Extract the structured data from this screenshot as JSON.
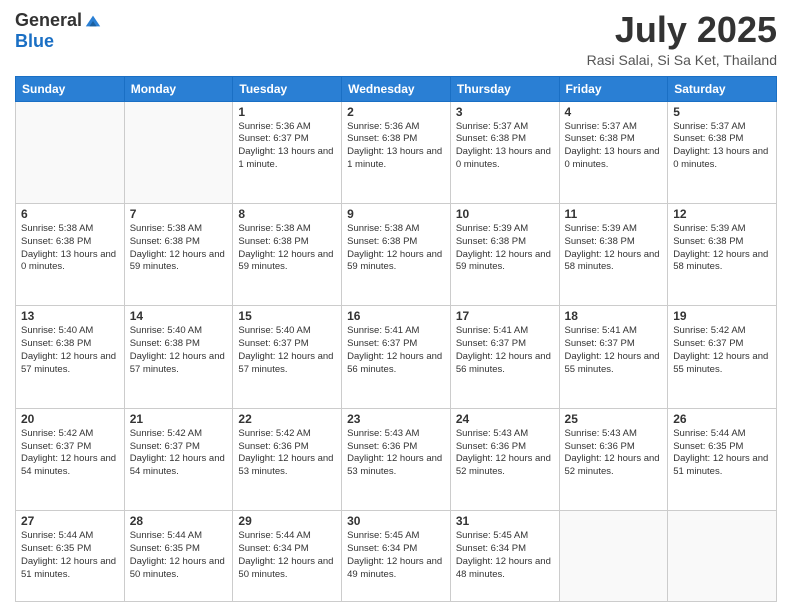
{
  "logo": {
    "general": "General",
    "blue": "Blue"
  },
  "header": {
    "month": "July 2025",
    "location": "Rasi Salai, Si Sa Ket, Thailand"
  },
  "days_of_week": [
    "Sunday",
    "Monday",
    "Tuesday",
    "Wednesday",
    "Thursday",
    "Friday",
    "Saturday"
  ],
  "weeks": [
    [
      {
        "day": "",
        "info": ""
      },
      {
        "day": "",
        "info": ""
      },
      {
        "day": "1",
        "info": "Sunrise: 5:36 AM\nSunset: 6:37 PM\nDaylight: 13 hours and 1 minute."
      },
      {
        "day": "2",
        "info": "Sunrise: 5:36 AM\nSunset: 6:38 PM\nDaylight: 13 hours and 1 minute."
      },
      {
        "day": "3",
        "info": "Sunrise: 5:37 AM\nSunset: 6:38 PM\nDaylight: 13 hours and 0 minutes."
      },
      {
        "day": "4",
        "info": "Sunrise: 5:37 AM\nSunset: 6:38 PM\nDaylight: 13 hours and 0 minutes."
      },
      {
        "day": "5",
        "info": "Sunrise: 5:37 AM\nSunset: 6:38 PM\nDaylight: 13 hours and 0 minutes."
      }
    ],
    [
      {
        "day": "6",
        "info": "Sunrise: 5:38 AM\nSunset: 6:38 PM\nDaylight: 13 hours and 0 minutes."
      },
      {
        "day": "7",
        "info": "Sunrise: 5:38 AM\nSunset: 6:38 PM\nDaylight: 12 hours and 59 minutes."
      },
      {
        "day": "8",
        "info": "Sunrise: 5:38 AM\nSunset: 6:38 PM\nDaylight: 12 hours and 59 minutes."
      },
      {
        "day": "9",
        "info": "Sunrise: 5:38 AM\nSunset: 6:38 PM\nDaylight: 12 hours and 59 minutes."
      },
      {
        "day": "10",
        "info": "Sunrise: 5:39 AM\nSunset: 6:38 PM\nDaylight: 12 hours and 59 minutes."
      },
      {
        "day": "11",
        "info": "Sunrise: 5:39 AM\nSunset: 6:38 PM\nDaylight: 12 hours and 58 minutes."
      },
      {
        "day": "12",
        "info": "Sunrise: 5:39 AM\nSunset: 6:38 PM\nDaylight: 12 hours and 58 minutes."
      }
    ],
    [
      {
        "day": "13",
        "info": "Sunrise: 5:40 AM\nSunset: 6:38 PM\nDaylight: 12 hours and 57 minutes."
      },
      {
        "day": "14",
        "info": "Sunrise: 5:40 AM\nSunset: 6:38 PM\nDaylight: 12 hours and 57 minutes."
      },
      {
        "day": "15",
        "info": "Sunrise: 5:40 AM\nSunset: 6:37 PM\nDaylight: 12 hours and 57 minutes."
      },
      {
        "day": "16",
        "info": "Sunrise: 5:41 AM\nSunset: 6:37 PM\nDaylight: 12 hours and 56 minutes."
      },
      {
        "day": "17",
        "info": "Sunrise: 5:41 AM\nSunset: 6:37 PM\nDaylight: 12 hours and 56 minutes."
      },
      {
        "day": "18",
        "info": "Sunrise: 5:41 AM\nSunset: 6:37 PM\nDaylight: 12 hours and 55 minutes."
      },
      {
        "day": "19",
        "info": "Sunrise: 5:42 AM\nSunset: 6:37 PM\nDaylight: 12 hours and 55 minutes."
      }
    ],
    [
      {
        "day": "20",
        "info": "Sunrise: 5:42 AM\nSunset: 6:37 PM\nDaylight: 12 hours and 54 minutes."
      },
      {
        "day": "21",
        "info": "Sunrise: 5:42 AM\nSunset: 6:37 PM\nDaylight: 12 hours and 54 minutes."
      },
      {
        "day": "22",
        "info": "Sunrise: 5:42 AM\nSunset: 6:36 PM\nDaylight: 12 hours and 53 minutes."
      },
      {
        "day": "23",
        "info": "Sunrise: 5:43 AM\nSunset: 6:36 PM\nDaylight: 12 hours and 53 minutes."
      },
      {
        "day": "24",
        "info": "Sunrise: 5:43 AM\nSunset: 6:36 PM\nDaylight: 12 hours and 52 minutes."
      },
      {
        "day": "25",
        "info": "Sunrise: 5:43 AM\nSunset: 6:36 PM\nDaylight: 12 hours and 52 minutes."
      },
      {
        "day": "26",
        "info": "Sunrise: 5:44 AM\nSunset: 6:35 PM\nDaylight: 12 hours and 51 minutes."
      }
    ],
    [
      {
        "day": "27",
        "info": "Sunrise: 5:44 AM\nSunset: 6:35 PM\nDaylight: 12 hours and 51 minutes."
      },
      {
        "day": "28",
        "info": "Sunrise: 5:44 AM\nSunset: 6:35 PM\nDaylight: 12 hours and 50 minutes."
      },
      {
        "day": "29",
        "info": "Sunrise: 5:44 AM\nSunset: 6:34 PM\nDaylight: 12 hours and 50 minutes."
      },
      {
        "day": "30",
        "info": "Sunrise: 5:45 AM\nSunset: 6:34 PM\nDaylight: 12 hours and 49 minutes."
      },
      {
        "day": "31",
        "info": "Sunrise: 5:45 AM\nSunset: 6:34 PM\nDaylight: 12 hours and 48 minutes."
      },
      {
        "day": "",
        "info": ""
      },
      {
        "day": "",
        "info": ""
      }
    ]
  ]
}
